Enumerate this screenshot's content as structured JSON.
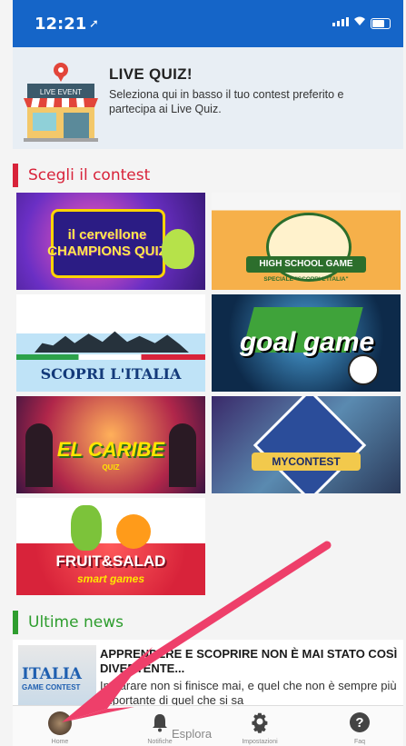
{
  "status": {
    "time": "12:21",
    "location_glyph": "➚"
  },
  "live_quiz": {
    "title": "LIVE QUIZ!",
    "description": "Seleziona qui in basso il tuo contest preferito e partecipa ai Live Quiz.",
    "sign_text": "LIVE EVENT"
  },
  "sections": {
    "contest": "Scegli il contest",
    "news": "Ultime news"
  },
  "contests": [
    {
      "name": "il cervellone CHAMPIONS QUIZ"
    },
    {
      "name": "HIGH SCHOOL GAME",
      "subtitle": "SPECIALE \"SCOPRI L'ITALIA\""
    },
    {
      "name": "SCOPRI L'ITALIA"
    },
    {
      "name": "goal game"
    },
    {
      "name": "EL CARIBE",
      "subtitle": "QUIZ"
    },
    {
      "name": "MYCONTEST"
    },
    {
      "name": "FRUIT&SALAD",
      "subtitle": "smart games"
    }
  ],
  "news": {
    "title": "APPRENDERE E SCOPRIRE NON È MAI STATO COSÌ DIVERTENTE...",
    "text": "Imparare non si finisce mai, e quel che non è sempre più importante di quel che si sa",
    "thumb_text": "ITALIA",
    "thumb_sub": "GAME CONTEST"
  },
  "tabbar": {
    "items": [
      {
        "label": "Home",
        "icon": "avatar"
      },
      {
        "label": "Notifiche",
        "icon": "bell-icon"
      },
      {
        "label": "Impostazioni",
        "icon": "gear-icon"
      },
      {
        "label": "Faq",
        "icon": "help-icon"
      }
    ],
    "explore_label": "Esplora"
  },
  "colors": {
    "status_bar": "#1565c8",
    "contest_accent": "#d8233a",
    "news_accent": "#2e9d2e",
    "arrow": "#ee3f6a"
  }
}
